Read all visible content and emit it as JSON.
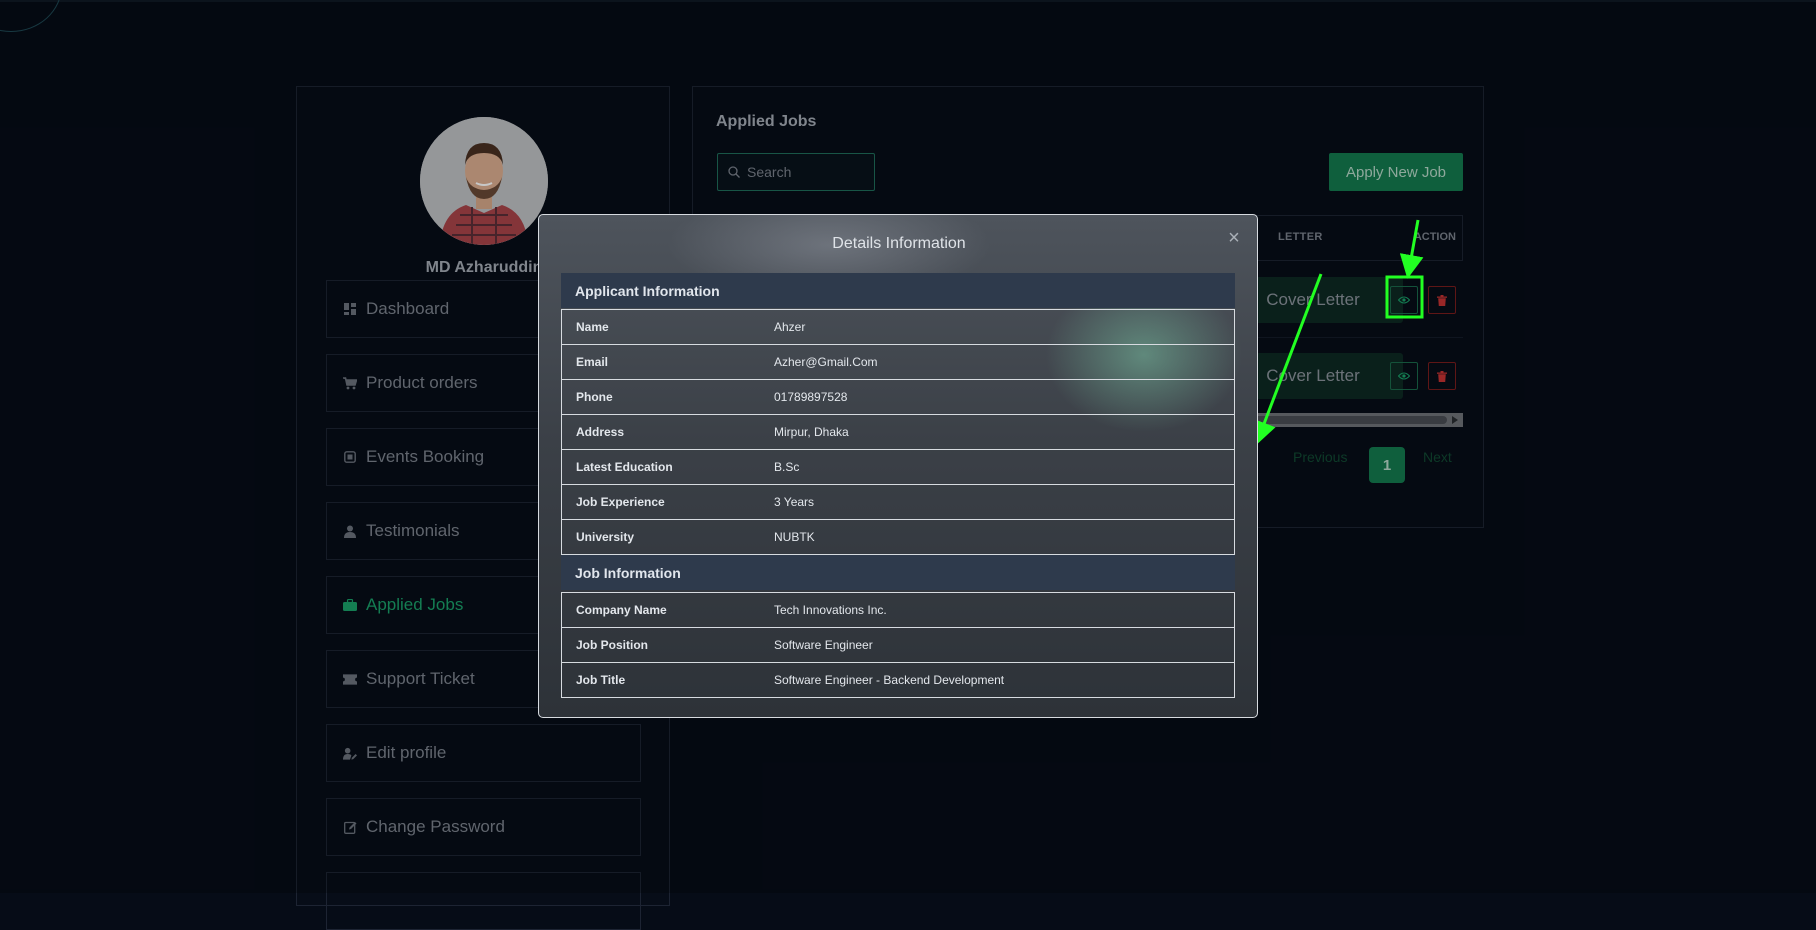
{
  "sidebar": {
    "profile_name": "MD Azharuddin",
    "items": [
      {
        "label": "Dashboard",
        "icon": "dashboard-icon"
      },
      {
        "label": "Product orders",
        "icon": "cart-icon"
      },
      {
        "label": "Events Booking",
        "icon": "ticket-icon"
      },
      {
        "label": "Testimonials",
        "icon": "user-icon"
      },
      {
        "label": "Applied Jobs",
        "icon": "briefcase-icon",
        "active": true
      },
      {
        "label": "Support Ticket",
        "icon": "support-ticket-icon"
      },
      {
        "label": "Edit profile",
        "icon": "user-edit-icon"
      },
      {
        "label": "Change Password",
        "icon": "edit-icon"
      }
    ]
  },
  "main": {
    "title": "Applied Jobs",
    "search_placeholder": "Search",
    "apply_button": "Apply New Job",
    "columns": {
      "cover_letter": "LETTER",
      "action": "ACTION"
    },
    "rows": [
      {
        "cover_letter_button": "Cover Letter"
      },
      {
        "cover_letter_button": "Cover Letter"
      }
    ],
    "pagination": {
      "previous": "Previous",
      "current": "1",
      "next": "Next"
    }
  },
  "modal": {
    "title": "Details Information",
    "close": "×",
    "applicant_section": "Applicant Information",
    "applicant": [
      {
        "label": "Name",
        "value": "Ahzer"
      },
      {
        "label": "Email",
        "value": "Azher@Gmail.Com"
      },
      {
        "label": "Phone",
        "value": "01789897528"
      },
      {
        "label": "Address",
        "value": "Mirpur, Dhaka"
      },
      {
        "label": "Latest Education",
        "value": "B.Sc"
      },
      {
        "label": "Job Experience",
        "value": "3 Years"
      },
      {
        "label": "University",
        "value": "NUBTK"
      }
    ],
    "job_section": "Job Information",
    "job": [
      {
        "label": "Company Name",
        "value": "Tech Innovations Inc."
      },
      {
        "label": "Job Position",
        "value": "Software Engineer"
      },
      {
        "label": "Job Title",
        "value": "Software Engineer - Backend Development"
      }
    ]
  },
  "colors": {
    "background": "#060c17",
    "accent_green": "#147a4f",
    "active_green": "#1aa06a",
    "danger_red": "#c43232",
    "annotation_green": "#22ff22",
    "modal_section": "#2e3a4c"
  }
}
